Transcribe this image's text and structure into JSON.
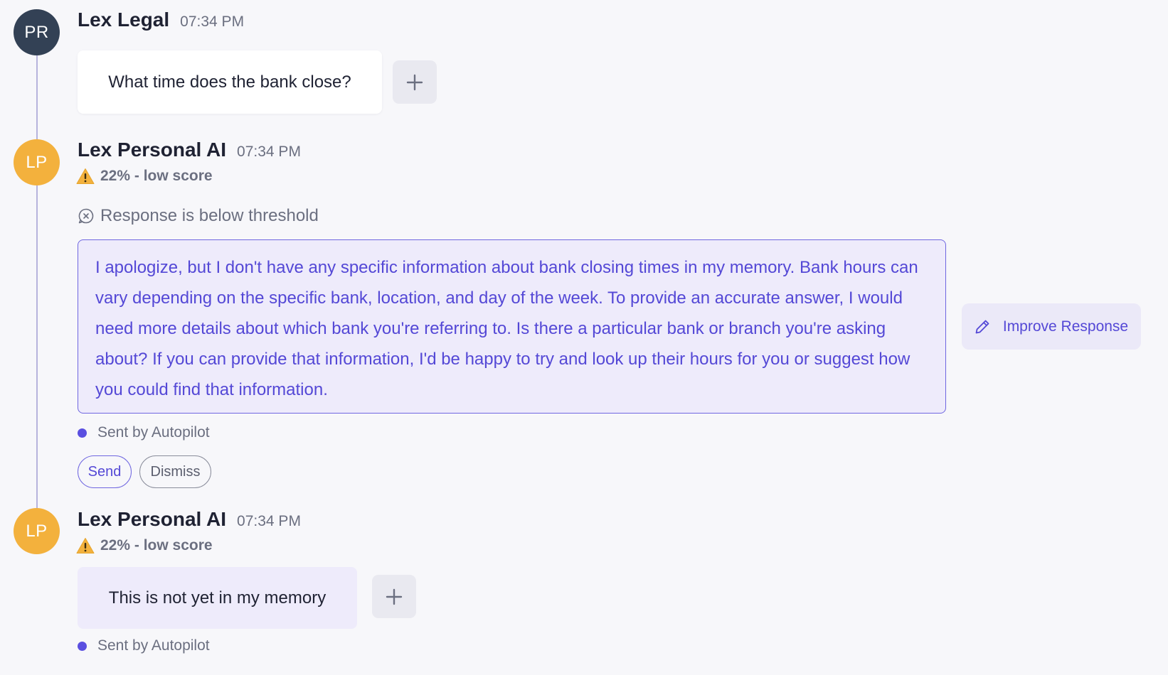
{
  "messages": [
    {
      "avatar_initials": "PR",
      "name": "Lex Legal",
      "time": "07:34 PM",
      "text": "What time does the bank close?"
    },
    {
      "avatar_initials": "LP",
      "name": "Lex Personal AI",
      "time": "07:34 PM",
      "score_label": "22% - low score",
      "status_label": "Response is below threshold",
      "draft_text": "I apologize, but I don't have any specific information about bank closing times in my memory. Bank hours can vary depending on the specific bank, location, and day of the week. To provide an accurate answer, I would need more details about which bank you're referring to. Is there a particular bank or branch you're asking about? If you can provide that information, I'd be happy to try and look up their hours for you or suggest how you could find that information.",
      "improve_label": "Improve Response",
      "sent_by": "Sent by Autopilot",
      "send_label": "Send",
      "dismiss_label": "Dismiss"
    },
    {
      "avatar_initials": "LP",
      "name": "Lex Personal AI",
      "time": "07:34 PM",
      "score_label": "22% - low score",
      "text": "This is not yet in my memory",
      "sent_by": "Sent by Autopilot"
    }
  ],
  "icons": {
    "plus": "plus-icon",
    "warning": "warning-icon",
    "below_threshold": "circle-x-icon",
    "pencil": "pencil-icon"
  },
  "colors": {
    "accent": "#5448d6",
    "warning": "#f3b13d",
    "avatar_user": "#334155",
    "avatar_ai": "#f3b13d"
  }
}
